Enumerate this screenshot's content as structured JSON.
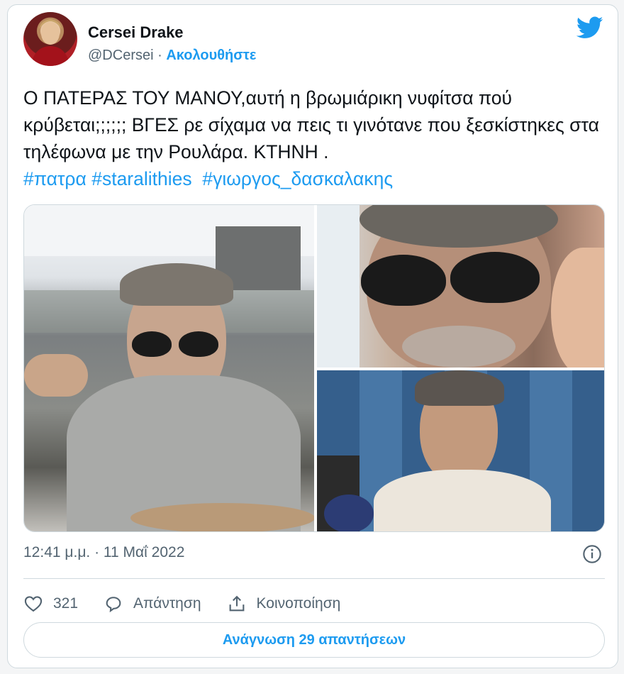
{
  "author": {
    "name": "Cersei Drake",
    "handle": "@DCersei",
    "separator": " · ",
    "follow_label": "Ακολουθήστε"
  },
  "tweet": {
    "text": "Ο ΠΑΤΕΡΑΣ ΤΟΥ ΜΑΝΟΥ,αυτή η βρωμιάρικη νυφίτσα πού κρύβεται;;;;;; ΒΓΕΣ ρε σίχαμα να πεις τι γινότανε που ξεσκίστηκες στα τηλέφωνα με την Ρουλάρα. ΚΤΗΝΗ .",
    "hashtags": [
      "#πατρα",
      "#staralithies",
      "#γιωργος_δασκαλακης"
    ]
  },
  "meta": {
    "timestamp": "12:41 μ.μ. · 11 Μαΐ 2022"
  },
  "actions": {
    "likes_count": "321",
    "reply_label": "Απάντηση",
    "share_label": "Κοινοποίηση"
  },
  "read_replies_label": "Ανάγνωση 29 απαντήσεων",
  "colors": {
    "accent": "#1d9bf0",
    "secondary_text": "#536471",
    "border": "#cfd9de"
  },
  "icons": [
    "twitter-bird-icon",
    "info-icon",
    "heart-icon",
    "reply-bubble-icon",
    "share-icon"
  ]
}
